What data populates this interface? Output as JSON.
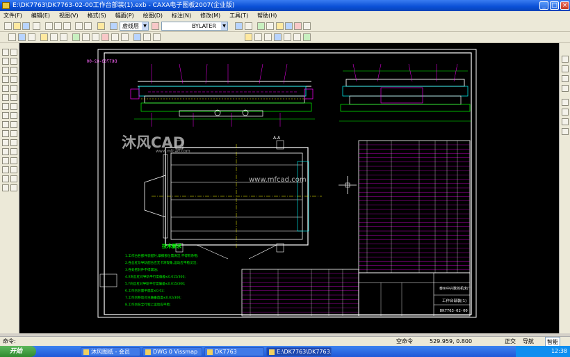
{
  "window": {
    "title": "E:\\DK7763\\DK7763-02-00工作台部装(1).exb - CAXA电子图板2007(企业版)",
    "buttons": [
      "_",
      "□",
      "×"
    ]
  },
  "menu": [
    "文件(F)",
    "编辑(E)",
    "视图(V)",
    "格式(S)",
    "幅面(P)",
    "绘图(D)",
    "标注(N)",
    "修改(M)",
    "工具(T)",
    "帮助(H)"
  ],
  "toolbar": {
    "layer_value": "虚线层",
    "linetype_value": "BYLATER"
  },
  "drawing": {
    "drawing_code_flipped": "DK7763-02-00",
    "section_label": "A-A",
    "tech_title": "技术要求",
    "tech_lines": [
      "1.工作台各部件装配时,摩擦部位需清洁,不得有杂物;",
      "2.各丝杠与导轨配合应无卡滞现象,运动应平稳灵活;",
      "3.各处密封件不得漏油;",
      "4.X向丝杠对导轨平行度偏差≤0.015/300;",
      "5.Y向丝杠对导轨平行度偏差≤0.015/300;",
      "6.工作台台面平面度≤0.02;",
      "7.工作台移动对主轴垂直度≤0.02/300;",
      "8.工作台在全行程上运动应平稳;"
    ],
    "title_block": {
      "company": "泰州中兴数控机床厂",
      "part_name": "工作台部装(1)",
      "drawing_no": "DK7763-02-00"
    },
    "watermark_brand": "沐风CAD",
    "watermark_url": "www.mfcad.com",
    "watermark_url2": "www.mfcad.com"
  },
  "command": {
    "prompt": "命令:",
    "mode": "空命令",
    "coords": "529.959, 0.800",
    "modes": [
      "正交",
      "导航",
      "智能"
    ]
  },
  "taskbar": {
    "start": "开始",
    "tasks": [
      "沐风图纸 - 会员",
      "DWG 0 Vissmap",
      "DK7763",
      "E:\\DK7763\\DK7763..."
    ],
    "clock": "12:38"
  },
  "colors": {
    "canvas": "#000000",
    "frame": "#ffffff",
    "magenta": "#ff00ff",
    "green": "#00ff00",
    "cyan": "#00ffff",
    "yellow": "#ffff00"
  }
}
